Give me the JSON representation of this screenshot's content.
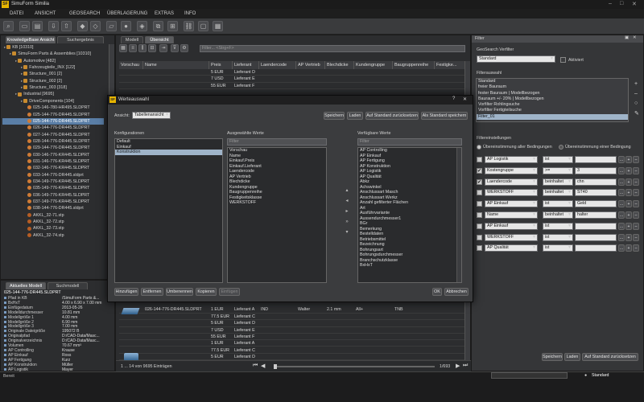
{
  "app": {
    "title": "SimuForm Similia",
    "icon_text": "SF"
  },
  "window_controls": [
    "–",
    "□",
    "✕"
  ],
  "menu": [
    "DATEI",
    "ANSICHT",
    "GEOSEARCH",
    "ÜBERLAGERUNG",
    "EXTRAS",
    "INFO"
  ],
  "left_tabs": [
    "KnowledgeBase Ansicht",
    "Suchergebnis"
  ],
  "tree": [
    {
      "label": "KB  [10310]",
      "indent": 0,
      "icon": "folder"
    },
    {
      "label": "SimuForm Parts & Assemblies  [10310]",
      "indent": 1,
      "icon": "folder"
    },
    {
      "label": "Automotive  [482]",
      "indent": 2,
      "icon": "folder"
    },
    {
      "label": "Fahrzeugteile_INX  [122]",
      "indent": 3,
      "icon": "folder"
    },
    {
      "label": "Structure_001  [2]",
      "indent": 3,
      "icon": "folder"
    },
    {
      "label": "Structure_002  [2]",
      "indent": 3,
      "icon": "folder"
    },
    {
      "label": "Structure_003  [318]",
      "indent": 3,
      "icon": "folder"
    },
    {
      "label": "Industrial  [9695]",
      "indent": 2,
      "icon": "folder"
    },
    {
      "label": "DriveComponents  [104]",
      "indent": 3,
      "icon": "folder"
    },
    {
      "label": "025-146-780-HR495.SLDPRT",
      "indent": 4,
      "icon": "part"
    },
    {
      "label": "025-144-776-DR445.SLDPRT",
      "indent": 4,
      "icon": "part"
    },
    {
      "label": "025-144-776-DR445.SLDPRT",
      "indent": 4,
      "icon": "part",
      "selected": true
    },
    {
      "label": "026-144-776-DR445.SLDPRT",
      "indent": 4,
      "icon": "part"
    },
    {
      "label": "027-144-776-DR445.SLDPRT",
      "indent": 4,
      "icon": "part"
    },
    {
      "label": "028-144-776-DR445.SLDPRT",
      "indent": 4,
      "icon": "part"
    },
    {
      "label": "029-144-776-DR445.SLDPRT",
      "indent": 4,
      "icon": "part"
    },
    {
      "label": "030-146-776-KR445.SLDPRT",
      "indent": 4,
      "icon": "part"
    },
    {
      "label": "031-146-776-KR445.SLDPRT",
      "indent": 4,
      "icon": "part"
    },
    {
      "label": "032-146-776-KR445.SLDPRT",
      "indent": 4,
      "icon": "part"
    },
    {
      "label": "033-144-776-DR445.sldprt",
      "indent": 4,
      "icon": "part"
    },
    {
      "label": "034-149-776-KR445.SLDPRT",
      "indent": 4,
      "icon": "part"
    },
    {
      "label": "035-149-776-KR445.SLDPRT",
      "indent": 4,
      "icon": "part"
    },
    {
      "label": "036-149-776-KR445.SLDPRT",
      "indent": 4,
      "icon": "part"
    },
    {
      "label": "037-149-776-KR445.SLDPRT",
      "indent": 4,
      "icon": "part"
    },
    {
      "label": "038-144-776-DR445.sldprt",
      "indent": 4,
      "icon": "part"
    },
    {
      "label": "AKKL_32-71.stp",
      "indent": 4,
      "icon": "file"
    },
    {
      "label": "AKKL_32-72.stp",
      "indent": 4,
      "icon": "file"
    },
    {
      "label": "AKKL_32-73.stp",
      "indent": 4,
      "icon": "file"
    },
    {
      "label": "AKKL_32-74.stp",
      "indent": 4,
      "icon": "file"
    }
  ],
  "bottom_tabs": [
    "Aktuelles Modell",
    "Suchmodell"
  ],
  "model_title": "025-144-776-DR445.SLDPRT",
  "props": [
    {
      "k": "Pfad in KB",
      "v": "/SimuForm Parts &..."
    },
    {
      "k": "BxHxT",
      "v": "4.00 x 6.90 x 7.00 mm"
    },
    {
      "k": "Einfügedatum",
      "v": "2013-05-26"
    },
    {
      "k": "Modelldurchmesser",
      "v": "10.81 mm"
    },
    {
      "k": "Modellgröße 1",
      "v": "4.00 mm"
    },
    {
      "k": "Modellgröße 2",
      "v": "6.90 mm"
    },
    {
      "k": "Modellgröße 3",
      "v": "7.00 mm"
    },
    {
      "k": "Originale Dateigröße",
      "v": "195072 B"
    },
    {
      "k": "Originalpfad",
      "v": "D:/CAD-Data/Masc..."
    },
    {
      "k": "Originalverzeichnis",
      "v": "D:/CAD-Data/Masc..."
    },
    {
      "k": "Volumen",
      "v": "70.67 mm³"
    },
    {
      "k": "AP Controlling",
      "v": "Krause"
    },
    {
      "k": "AP Einkauf",
      "v": "Ross"
    },
    {
      "k": "AP Fertigung",
      "v": "Kurz"
    },
    {
      "k": "AP Konstruktion",
      "v": "Müller"
    },
    {
      "k": "AP Logistik",
      "v": "Mayer"
    }
  ],
  "center_tabs": [
    "Modell",
    "Übersicht"
  ],
  "filter_placeholder": "Filter...  <Strg+F>",
  "grid_headers": [
    "Vorschau",
    "Name",
    "Preis",
    "Lieferant",
    "Laendercode",
    "AP Vertrieb",
    "Blechdicke",
    "Kundengruppe",
    "Baugruppenreihe",
    "Festigke..."
  ],
  "grid_top_rows": [
    {
      "preis": "5 EUR",
      "lief": "Lieferant D"
    },
    {
      "preis": "7 USD",
      "lief": "Lieferant E"
    },
    {
      "preis": "55 EUR",
      "lief": "Lieferant F"
    }
  ],
  "grid_bottom_first": {
    "name": "026-144-776-DR445.SLDPRT",
    "preis": "1 EUR",
    "lief": "Lieferant A",
    "land": "IND",
    "vertrieb": "Walter",
    "blech": "2.1 mm",
    "kunde": "All+",
    "bau": "TNB"
  },
  "grid_bottom_rows": [
    {
      "preis": "77.5 EUR",
      "lief": "Lieferant C"
    },
    {
      "preis": "5 EUR",
      "lief": "Lieferant D"
    },
    {
      "preis": "7 USD",
      "lief": "Lieferant E"
    },
    {
      "preis": "55 EUR",
      "lief": "Lieferant F"
    },
    {
      "preis": "1 EUR",
      "lief": "Lieferant A"
    },
    {
      "preis": "77.5 EUR",
      "lief": "Lieferant C"
    },
    {
      "preis": "5 EUR",
      "lief": "Lieferant D"
    },
    {
      "preis": "7 USD",
      "lief": "Lieferant E"
    }
  ],
  "pager": {
    "text": "1 ... 14 von 9695 Einträgen",
    "page": "1/693"
  },
  "dialog": {
    "title": "Werteauswahl",
    "ansicht_label": "Ansicht:",
    "ansicht_value": "Tabellenansicht",
    "top_buttons": [
      "Speichern",
      "Laden",
      "Auf Standard zurücksetzen",
      "Als Standard speichern"
    ],
    "konfig_label": "Konfigurationen",
    "konfigs": [
      "Default",
      "Einkauf",
      "Konstruktion"
    ],
    "konfig_selected": 2,
    "ausgewaehlt_label": "Ausgewählte Werte",
    "verfuegbar_label": "Verfügbare Werte",
    "filter_placeholder": "Filter",
    "selected_values": [
      "Vorschau",
      "Name",
      "Einkauf.Preis",
      "Einkauf.Lieferant",
      "Laendercode",
      "AP Vertrieb",
      "Blechdicke",
      "Kundengruppe",
      "Baugruppenreihe",
      "Festigkeitsklasse",
      "WERKSTOFF"
    ],
    "available_values": [
      "AP Controlling",
      "AP Einkauf",
      "AP Fertigung",
      "AP Konstruktion",
      "AP Logistik",
      "AP Qualität",
      "Abkz",
      "Achswinkel",
      "Anschlussart Masch",
      "Anschlussart Werkz",
      "Anzahl gefilterter Flächen",
      "Art",
      "Ausführvariante",
      "Aussendurchmesser1",
      "BGr",
      "Bemerkung",
      "Bestelldaten",
      "Betriebsmittel",
      "Bezeichnung",
      "Bohrungsart",
      "Bohrungsdurchmesser",
      "Branchschutzklasse",
      "BxHxT"
    ],
    "bottom_buttons": [
      "Hinzufügen",
      "Entfernen",
      "Umbenennen",
      "Kopieren",
      "Einfügen"
    ],
    "ok": "OK",
    "cancel": "Abbrechen"
  },
  "right": {
    "header": "Filter",
    "geo_label": "GeoSearch Verfilter",
    "geo_value": "Standard",
    "aktiviert": "Aktiviert",
    "filterauswahl_label": "Filterauswahl",
    "filter_list": [
      "Standard",
      "freier Bauraum",
      "fester Bauraum | Modellbezogen",
      "Bauraum +/- 20% | Modellbezogen",
      "Vorfilter Rohlingsuche",
      "Vorfilter Fertigteilsuche",
      "Filter_01"
    ],
    "filter_selected": 6,
    "einstellungen_label": "Filtereinstellungen",
    "radio1": "Übereinstimmung aller Bedingungen",
    "radio2": "Übereinstimmung einer Bedingung",
    "conditions": [
      {
        "checked": false,
        "field": "AP Logistik",
        "op": "ist",
        "val": ""
      },
      {
        "checked": true,
        "field": "Kostengruppe",
        "op": ">=",
        "val": "3"
      },
      {
        "checked": true,
        "field": "Laendercode",
        "op": "beinhaltet",
        "val": "chn"
      },
      {
        "checked": false,
        "field": "WERKSTOFF",
        "op": "beinhaltet",
        "val": "ST40"
      },
      {
        "checked": false,
        "field": "AP Einkauf",
        "op": "ist",
        "val": "Geld"
      },
      {
        "checked": false,
        "field": "Name",
        "op": "beinhaltet",
        "val": "halter"
      },
      {
        "checked": false,
        "field": "AP Einkauf",
        "op": "ist",
        "val": ""
      },
      {
        "checked": false,
        "field": "WERKSTOFF",
        "op": "ist",
        "val": ""
      },
      {
        "checked": false,
        "field": "AP Qualität",
        "op": "ist",
        "val": ""
      }
    ],
    "buttons": [
      "Speichern",
      "Laden",
      "Auf Standard zurücksetzen"
    ]
  },
  "status": {
    "left": "Bereit",
    "mode": "Standard"
  }
}
